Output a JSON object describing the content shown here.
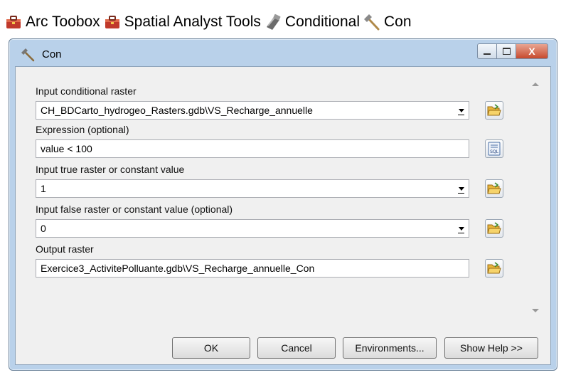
{
  "breadcrumb": [
    {
      "label": "Arc Toobox",
      "icon": "toolbox-icon"
    },
    {
      "label": "Spatial Analyst Tools",
      "icon": "toolbox-icon"
    },
    {
      "label": "Conditional",
      "icon": "toolset-icon"
    },
    {
      "label": "Con",
      "icon": "hammer-icon"
    }
  ],
  "window": {
    "title": "Con",
    "controls": {
      "minimize": "minimize",
      "maximize": "maximize",
      "close": "X"
    }
  },
  "form": {
    "input_conditional_raster": {
      "label": "Input conditional raster",
      "value": "CH_BDCarto_hydrogeo_Rasters.gdb\\VS_Recharge_annuelle"
    },
    "expression": {
      "label": "Expression (optional)",
      "value": "value < 100",
      "button_text": "SQL"
    },
    "input_true": {
      "label": "Input true raster or constant value",
      "value": "1"
    },
    "input_false": {
      "label": "Input false raster or constant value (optional)",
      "value": "0"
    },
    "output_raster": {
      "label": "Output raster",
      "value": "Exercice3_ActivitePolluante.gdb\\VS_Recharge_annuelle_Con"
    }
  },
  "buttons": {
    "ok": "OK",
    "cancel": "Cancel",
    "environments": "Environments...",
    "show_help": "Show Help >>"
  },
  "colors": {
    "window_frame": "#b9d1ea",
    "client_bg": "#f0f0f0",
    "close_button": "#c74a2e",
    "folder_icon": "#e8b53c"
  }
}
